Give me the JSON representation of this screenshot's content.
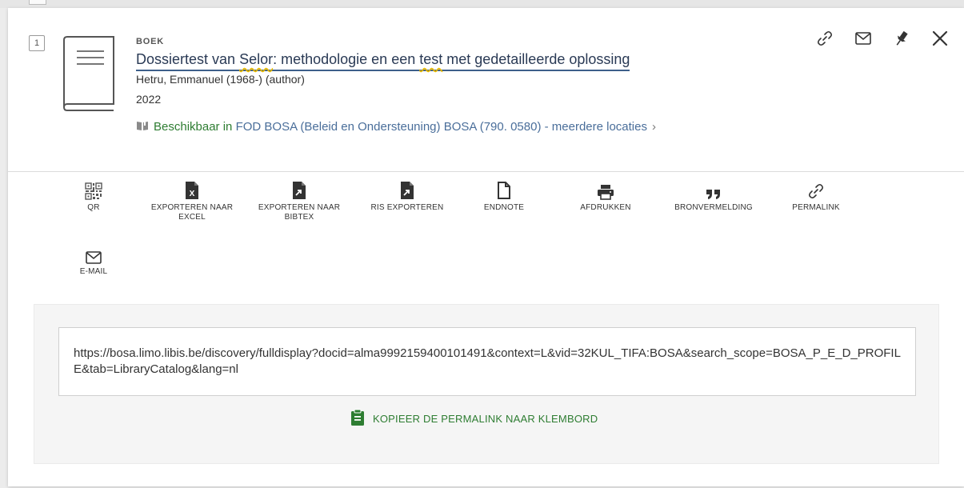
{
  "record": {
    "number": "1",
    "type": "BOEK",
    "title_parts": [
      "Dossiertest van ",
      "Selor",
      ": methodologie en een ",
      "test",
      " met gedetailleerde oplossing"
    ],
    "author": "Hetru, Emmanuel (1968-) (author)",
    "year": "2022",
    "availability": {
      "status": "Beschikbaar in",
      "location": "FOD BOSA (Beleid en Ondersteuning)  BOSA (790. 0580) - meerdere locaties",
      "chevron": "›"
    }
  },
  "top_actions": [
    "link-icon",
    "mail-icon",
    "pin-icon",
    "close-icon"
  ],
  "tools": [
    {
      "label": "QR"
    },
    {
      "label": "EXPORTEREN NAAR EXCEL"
    },
    {
      "label": "EXPORTEREN NAAR BIBTEX"
    },
    {
      "label": "RIS EXPORTEREN"
    },
    {
      "label": "ENDNOTE"
    },
    {
      "label": "AFDRUKKEN"
    },
    {
      "label": "BRONVERMELDING"
    },
    {
      "label": "PERMALINK"
    },
    {
      "label": "E-MAIL"
    }
  ],
  "permalink": {
    "url": "https://bosa.limo.libis.be/discovery/fulldisplay?docid=alma9992159400101491&context=L&vid=32KUL_TIFA:BOSA&search_scope=BOSA_P_E_D_PROFILE&tab=LibraryCatalog&lang=nl",
    "copy_label": "KOPIEER DE PERMALINK NAAR KLEMBORD"
  },
  "colors": {
    "accent_green": "#2e7d32",
    "title_blue": "#2a3a55",
    "link_blue": "#4a6e9a",
    "highlight_yellow": "#e6b800"
  }
}
